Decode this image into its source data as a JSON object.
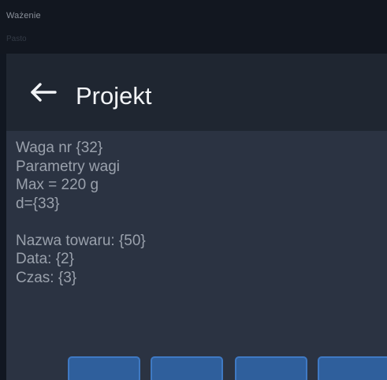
{
  "header": {
    "mode_title": "Ważenie",
    "mode_subtitle": "Pasto"
  },
  "dialog": {
    "title": "Projekt",
    "back_icon": "arrow-left-icon",
    "lines": [
      "Waga nr {32}",
      "Parametry wagi",
      "Max = 220 g",
      "d={33}",
      "",
      "Nazwa towaru: {50}",
      "Data: {2}",
      "Czas: {3}"
    ]
  },
  "colors": {
    "background": "#111721",
    "dialog_background": "#2b3342",
    "header_background": "#1f2631",
    "title_text": "#f2f4f7",
    "body_text": "#9aa1ac",
    "button_fill": "#2f5f9c",
    "button_border": "#3f79c3"
  },
  "function_buttons": [
    {
      "name": "function-button-1"
    },
    {
      "name": "function-button-2"
    },
    {
      "name": "function-button-3"
    },
    {
      "name": "function-button-4"
    }
  ]
}
